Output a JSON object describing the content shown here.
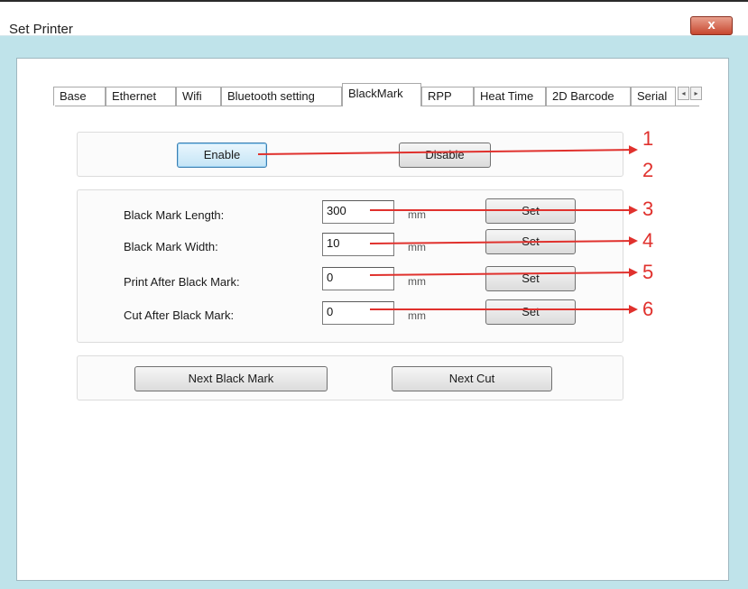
{
  "window": {
    "title": "Set Printer",
    "close_label": "x"
  },
  "tabs": [
    "Base",
    "Ethernet",
    "Wifi",
    "Bluetooth setting",
    "BlackMark",
    "RPP",
    "Heat Time",
    "2D Barcode",
    "Serial"
  ],
  "active_tab": "BlackMark",
  "tab_scroll": {
    "left": "◂",
    "right": "▸"
  },
  "mode": {
    "enable_label": "Enable",
    "disable_label": "Disable"
  },
  "settings": {
    "length": {
      "label": "Black Mark Length:",
      "value": "300",
      "unit": "mm",
      "set_label": "Set"
    },
    "width": {
      "label": "Black Mark Width:",
      "value": "10",
      "unit": "mm",
      "set_label": "Set"
    },
    "print_after": {
      "label": "Print After Black Mark:",
      "value": "0",
      "unit": "mm",
      "set_label": "Set"
    },
    "cut_after": {
      "label": "Cut After Black Mark:",
      "value": "0",
      "unit": "mm",
      "set_label": "Set"
    }
  },
  "actions": {
    "next_black_mark_label": "Next Black Mark",
    "next_cut_label": "Next Cut"
  },
  "annotations": {
    "n1": "1",
    "n2": "2",
    "n3": "3",
    "n4": "4",
    "n5": "5",
    "n6": "6",
    "arrow_color": "#e0312d"
  }
}
